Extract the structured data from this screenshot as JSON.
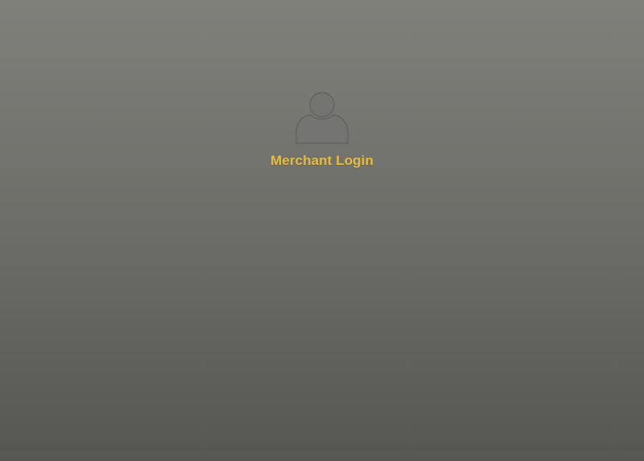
{
  "login": {
    "icon": "user-silhouette-icon",
    "label": "Merchant Login"
  },
  "colors": {
    "accent": "#e8bc3a",
    "background_top": "#7f807b",
    "background_bottom": "#565753"
  }
}
